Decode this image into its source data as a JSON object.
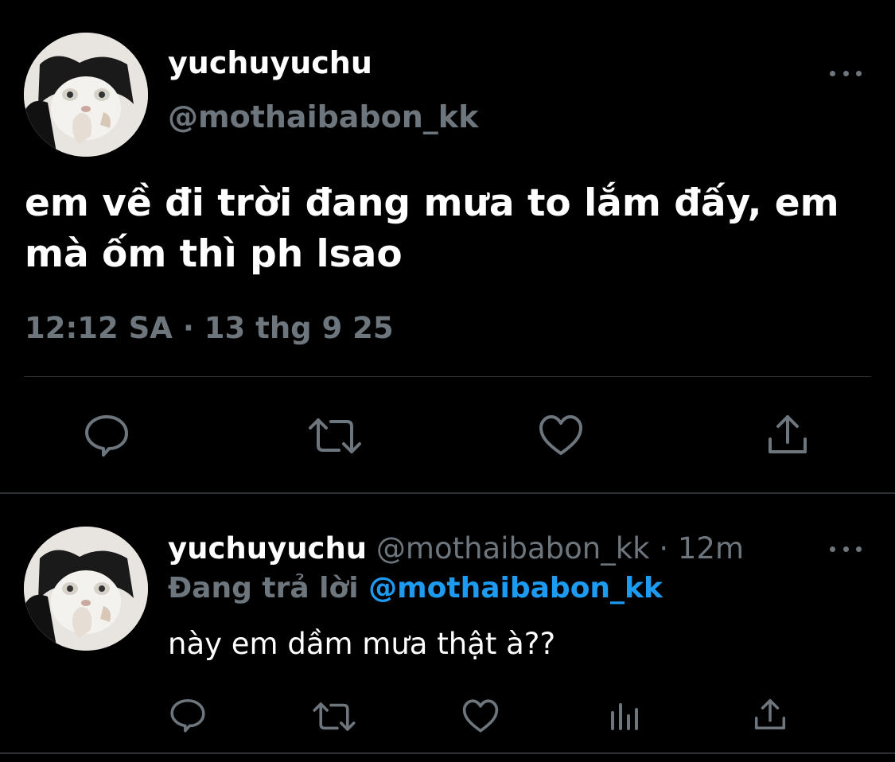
{
  "main_tweet": {
    "display_name": "yuchuyuchu",
    "handle": "@mothaibabon_kk",
    "text": "em về đi trời đang mưa to lắm đấy, em mà ốm thì ph lsao",
    "timestamp": "12:12 SA · 13 thg 9 25",
    "actions": [
      "reply-icon",
      "retweet-icon",
      "like-icon",
      "share-icon"
    ]
  },
  "reply_tweet": {
    "display_name": "yuchuyuchu",
    "handle_time": "@mothaibabon_kk · 12m",
    "replying_label": "Đang trả lời",
    "replying_to": "@mothaibabon_kk",
    "text": "này em dầm mưa thật à??",
    "actions": [
      "reply-icon",
      "retweet-icon",
      "like-icon",
      "analytics-icon",
      "share-icon"
    ]
  },
  "colors": {
    "background": "#000000",
    "primary_text": "#ffffff",
    "secondary_text": "#6e767d",
    "link": "#1d9bf0",
    "divider": "#2f3336"
  }
}
